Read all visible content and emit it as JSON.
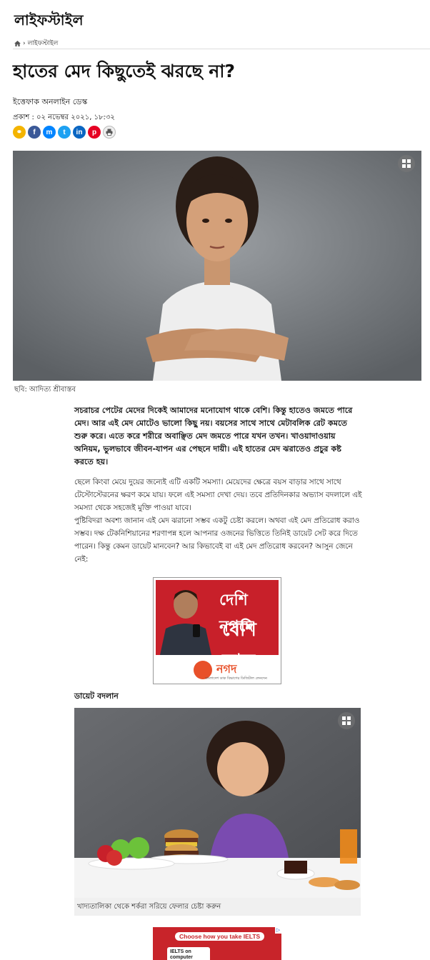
{
  "section": {
    "title": "লাইফস্টাইল"
  },
  "breadcrumb": {
    "current": "লাইফস্টাইল",
    "separator": "›"
  },
  "article": {
    "headline": "হাতের মেদ কিছুতেই ঝরছে না?",
    "byline": "ইত্তেফাক অনলাইন ডেস্ক",
    "published": "প্রকাশ : ০২ নভেম্বর ২০২১, ১৮:৩২",
    "share": [
      "link-icon",
      "facebook-icon",
      "messenger-icon",
      "twitter-icon",
      "linkedin-icon",
      "pinterest-icon",
      "print-icon"
    ],
    "hero_caption": "ছবি: আদিত্য শ্রীবাস্তব",
    "lead": "সচরাচর পেটের মেদের দিকেই আমাদের মনোযোগ থাকে বেশি। কিন্তু হাতেও জমতে পারে মেদ। আর এই মেদ মোটেও ভালো কিছু নয়। বয়সের সাথে সাথে মেটাবলিক রেট কমতে শুরু করে। এতে করে শরীরে অবাঞ্ছিত মেদ জমতে পারে যখন তখন। খাওয়াদাওয়ায় অনিয়ম, ভুলভাবে জীবন-যাপন এর পেছনে দায়ী। এই হাতের মেদ ঝরাতেও প্রচুর কষ্ট করতে হয়।",
    "paragraphs": [
      "ছেলে কিংবা মেয়ে দুয়ের জন্যেই এটি একটি সমস্যা। মেয়েদের ক্ষেত্রে বয়স বাড়ার সাথে সাথে টেস্টোস্টেরনের ক্ষরণ কমে যায়। ফলে এই সমস্যা দেখা দেয়। তবে প্রতিদিনকার অভ্যাস বদলালে এই সমস্যা থেকে সহজেই মুক্তি পাওয়া যাবে।",
      "পুষ্টিবিদরা অবশ্য জানান এই মেদ ঝরানো সম্ভব একটু চেষ্টা করলে। অথবা এই মেদ প্রতিরোধ করাও সম্ভব। দক্ষ টেকনিশিয়ানের শরণাপন্ন হলে আপনার ওজনের ভিত্তিতে তিনিই ডায়েট সেট করে দিতে পারেন। কিন্তু কেমন ডায়েট মানবেন? আর কিভাবেই বা এই মেদ প্রতিরোধ করবেন? আসুন জেনে নেই:"
    ],
    "subhead": "ডায়েট বদলান",
    "image2_caption": "খাদ্যতালিকা থেকে শর্করা সরিয়ে ফেলার চেষ্টা করুন"
  },
  "ads": {
    "nagad": {
      "line1": "দেশি নগদে",
      "line2": "বেশি লাভ",
      "brand": "নগদ",
      "tagline": "বাংলাদেশ ডাক বিভাগের ডিজিটাল লেনদেন"
    },
    "ielts": {
      "headline": "Choose how you take IELTS",
      "card": "IELTS on computer"
    }
  },
  "colors": {
    "facebook": "#3b5998",
    "messenger": "#0084ff",
    "twitter": "#1da1f2",
    "linkedin": "#0a66c2",
    "pinterest": "#e60023",
    "nagad_red": "#c8202a",
    "link": "#f4b400",
    "print": "#555555"
  }
}
